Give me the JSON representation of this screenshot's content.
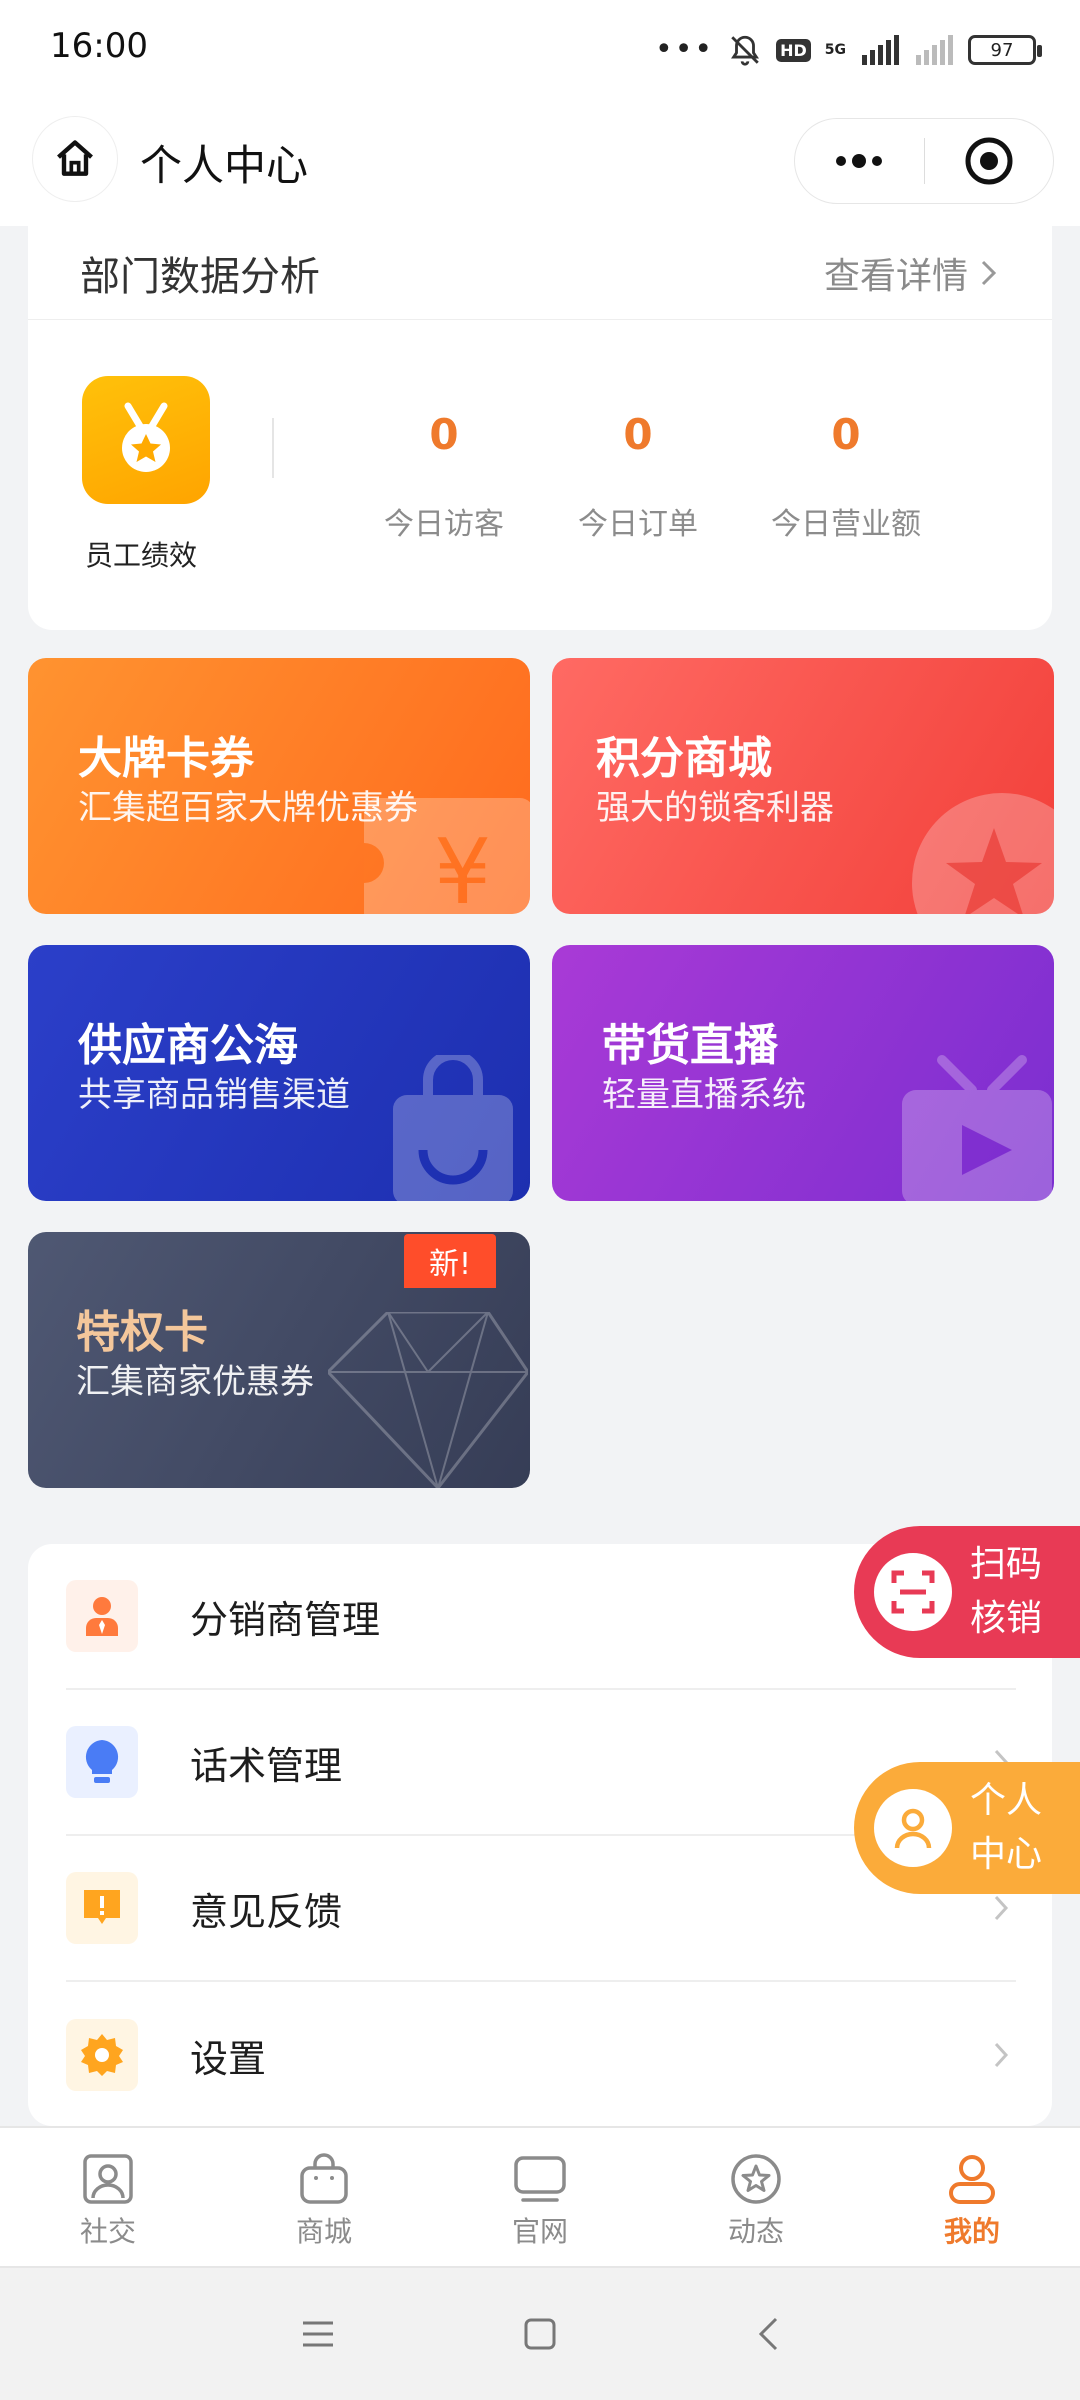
{
  "status_bar": {
    "time": "16:00",
    "battery": "97",
    "network": "5G",
    "hd": "HD"
  },
  "nav": {
    "title": "个人中心",
    "icons": [
      "home-icon",
      "more-dots-icon",
      "target-icon"
    ]
  },
  "dept": {
    "title": "部门数据分析",
    "more_label": "查看详情",
    "performance_label": "员工绩效",
    "stats": [
      {
        "value": "0",
        "label": "今日访客"
      },
      {
        "value": "0",
        "label": "今日订单"
      },
      {
        "value": "0",
        "label": "今日营业额"
      }
    ]
  },
  "tiles": {
    "coupon": {
      "title": "大牌卡券",
      "subtitle": "汇集超百家大牌优惠券"
    },
    "points": {
      "title": "积分商城",
      "subtitle": "强大的锁客利器"
    },
    "supplier": {
      "title": "供应商公海",
      "subtitle": "共享商品销售渠道"
    },
    "live": {
      "title": "带货直播",
      "subtitle": "轻量直播系统"
    },
    "vip": {
      "title": "特权卡",
      "subtitle": "汇集商家优惠券",
      "badge": "新!"
    }
  },
  "menu": [
    {
      "label": "分销商管理",
      "icon": "distributor-icon",
      "color": "#ff7a3d",
      "bg": "#fff1ea"
    },
    {
      "label": "话术管理",
      "icon": "lightbulb-icon",
      "color": "#4a7cf5",
      "bg": "#eaf0ff"
    },
    {
      "label": "意见反馈",
      "icon": "feedback-icon",
      "color": "#ffa51f",
      "bg": "#fff5e3"
    },
    {
      "label": "设置",
      "icon": "gear-icon",
      "color": "#ffa51f",
      "bg": "#fff5e3"
    }
  ],
  "floating": {
    "scan": {
      "line1": "扫码",
      "line2": "核销",
      "color": "#e83a55"
    },
    "me": {
      "line1": "个人",
      "line2": "中心",
      "color": "#fbab3a"
    }
  },
  "tabs": [
    {
      "label": "社交",
      "icon": "social-icon"
    },
    {
      "label": "商城",
      "icon": "bag-icon"
    },
    {
      "label": "官网",
      "icon": "monitor-icon"
    },
    {
      "label": "动态",
      "icon": "star-circle-icon"
    },
    {
      "label": "我的",
      "icon": "user-icon",
      "active": true
    }
  ],
  "colors": {
    "accent": "#ef7a2c"
  }
}
